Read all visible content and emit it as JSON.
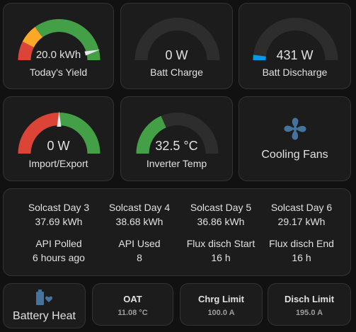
{
  "colors": {
    "background": "#111111",
    "card": "#1c1c1c",
    "track": "#2d2d2d",
    "green": "#43a047",
    "orange": "#ffa726",
    "red": "#db4437",
    "blue": "#039be5",
    "fan_blue": "#44739e",
    "needle": "#e8e8e8"
  },
  "gauges": [
    {
      "label": "Today's Yield",
      "value": "20.0 kWh",
      "level": 0.92,
      "style": "segmented",
      "needle": true
    },
    {
      "label": "Batt Charge",
      "value": "0 W",
      "level": 0.0,
      "style": "fill"
    },
    {
      "label": "Batt Discharge",
      "value": "431 W",
      "level": 0.04,
      "style": "fill"
    },
    {
      "label": "Import/Export",
      "value": "0 W",
      "level": 0.5,
      "style": "segmented",
      "needle": true
    },
    {
      "label": "Inverter Temp",
      "value": "32.5 °C",
      "level": 0.37,
      "style": "fill"
    }
  ],
  "cooling_fans": {
    "label": "Cooling Fans",
    "icon": "fan-icon"
  },
  "stats": [
    {
      "title": "Solcast Day 3",
      "value": "37.69 kWh"
    },
    {
      "title": "Solcast Day 4",
      "value": "38.68 kWh"
    },
    {
      "title": "Solcast Day 5",
      "value": "36.86 kWh"
    },
    {
      "title": "Solcast Day 6",
      "value": "29.17 kWh"
    },
    {
      "title": "API Polled",
      "value": "6 hours ago"
    },
    {
      "title": "API Used",
      "value": "8"
    },
    {
      "title": "Flux disch Start",
      "value": "16 h"
    },
    {
      "title": "Flux disch End",
      "value": "16 h"
    }
  ],
  "battery_heat": {
    "label": "Battery Heat",
    "icon": "battery-heart-icon"
  },
  "chips": [
    {
      "title": "OAT",
      "value": "11.08 °C"
    },
    {
      "title": "Chrg Limit",
      "value": "100.0 A"
    },
    {
      "title": "Disch Limit",
      "value": "195.0 A"
    }
  ]
}
